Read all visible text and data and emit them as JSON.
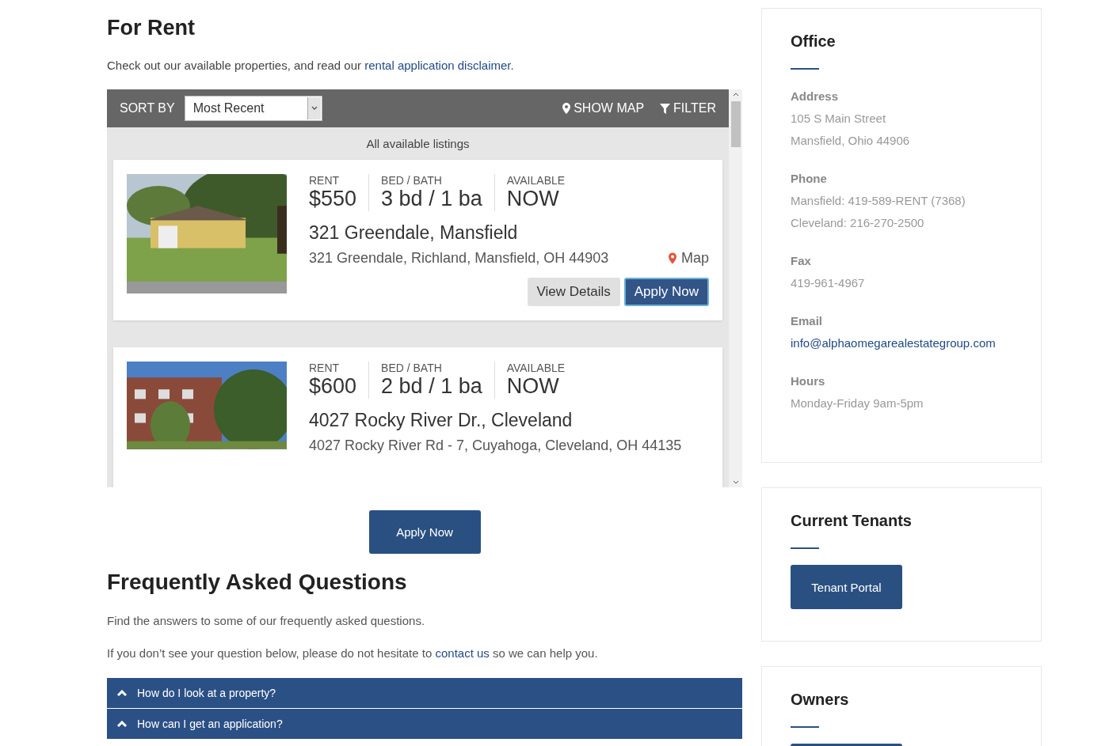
{
  "main": {
    "title": "For Rent",
    "intro": {
      "text": "Check out our available properties, and read our",
      "link": "rental application disclaimer",
      "end": "."
    },
    "toolbar": {
      "sort_label": "SORT BY",
      "sort_value": "Most Recent",
      "show_map": "SHOW MAP",
      "filter": "FILTER"
    },
    "listings_caption": "All available listings",
    "listings": [
      {
        "kind": "house",
        "rent_label": "RENT",
        "rent": "$550",
        "bed_label": "BED / BATH",
        "bed": "3 bd / 1 ba",
        "avail_label": "AVAILABLE",
        "avail": "NOW",
        "title": "321 Greendale, Mansfield",
        "address": "321 Greendale, Richland, Mansfield, OH 44903",
        "map": "Map",
        "buttons": [
          "View Details",
          "Apply Now"
        ]
      },
      {
        "kind": "apartment",
        "rent_label": "RENT",
        "rent": "$600",
        "bed_label": "BED / BATH",
        "bed": "2 bd / 1 ba",
        "avail_label": "AVAILABLE",
        "avail": "NOW",
        "title": "4027 Rocky River Dr., Cleveland",
        "address": "4027 Rocky River Rd - 7, Cuyahoga, Cleveland, OH 44135"
      }
    ],
    "apply_button": "Apply Now",
    "faq": {
      "title": "Frequently Asked Questions",
      "intro": "Find the answers to some of our frequently asked questions.",
      "note": {
        "text": "If you don’t see your question below, please do not hesitate to",
        "link": "contact us",
        "end": "so we can help you."
      },
      "questions": [
        "How do I look at a property?",
        "How can I get an application?"
      ]
    }
  },
  "sidebar": [
    {
      "kind": "contacts",
      "title": "Office",
      "sections": [
        {
          "label": "Address",
          "lines": [
            "105 S Main Street",
            "Mansfield, Ohio 44906"
          ]
        },
        {
          "label": "Phone",
          "lines": [
            "Mansfield: 419-589-RENT (7368)",
            "Cleveland: 216-270-2500"
          ]
        },
        {
          "label": "Fax",
          "lines": [
            "419-961-4967"
          ]
        },
        {
          "label": "Email",
          "link": "info@alphaomegarealestategroup.com"
        },
        {
          "label": "Hours",
          "lines": [
            "Monday-Friday 9am-5pm"
          ]
        }
      ]
    },
    {
      "kind": "button",
      "title": "Current Tenants",
      "button": "Tenant Portal"
    },
    {
      "kind": "hidden-button",
      "title": "Owners"
    }
  ]
}
